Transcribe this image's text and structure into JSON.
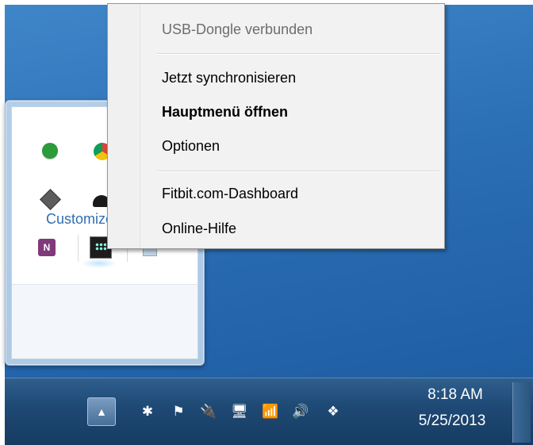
{
  "context_menu": {
    "items": [
      {
        "label": "USB-Dongle verbunden"
      },
      {
        "label": "Jetzt synchronisieren"
      },
      {
        "label": "Hauptmenü öffnen"
      },
      {
        "label": "Optionen"
      },
      {
        "label": "Fitbit.com-Dashboard"
      },
      {
        "label": "Online-Hilfe"
      }
    ]
  },
  "tray_flyout": {
    "customize_label": "Customize...",
    "icons": [
      "green-circle-icon",
      "chrome-icon",
      "diamond-icon",
      "black-app-icon",
      "onenote-icon",
      "fitbit-icon",
      "app-icon"
    ]
  },
  "taskbar": {
    "show_hidden_icon": "▲",
    "tray_icons": [
      {
        "name": "bluetooth-icon",
        "glyph": "✱"
      },
      {
        "name": "action-center-flag-icon",
        "glyph": "⚑"
      },
      {
        "name": "power-icon",
        "glyph": "🔌"
      },
      {
        "name": "network-icon",
        "glyph": "🖥"
      },
      {
        "name": "signal-icon",
        "glyph": "📶"
      },
      {
        "name": "volume-icon",
        "glyph": "🔊"
      },
      {
        "name": "dropbox-icon",
        "glyph": "❖"
      }
    ],
    "clock": {
      "time": "8:18 AM",
      "date": "5/25/2013"
    }
  },
  "colors": {
    "desktop": "#2b6fb5",
    "taskbar": "#1f4a76",
    "link": "#2f6fb2"
  }
}
